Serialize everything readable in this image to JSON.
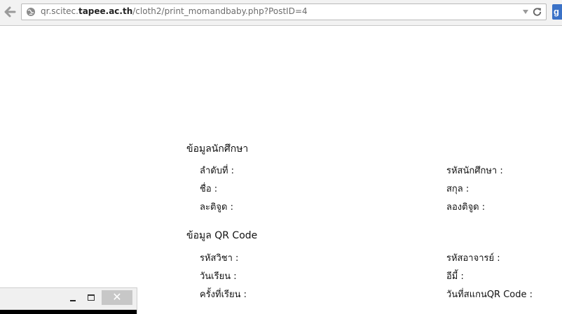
{
  "browser": {
    "url_prefix": "qr.scitec.",
    "url_domain": "tapee.ac.th",
    "url_path": "/cloth2/print_momandbaby.php?PostID=4",
    "back_icon": "back-arrow-icon",
    "site_icon": "globe-icon",
    "reload_icon": "reload-icon",
    "extension_letter": "g"
  },
  "student_section": {
    "title": "ข้อมูลนักศึกษา",
    "fields": {
      "order_label": "ลำดับที่ :",
      "student_id_label": "รหัสนักศึกษา :",
      "first_name_label": "ชื่อ :",
      "last_name_label": "สกุล :",
      "latitude_label": "ละติจูด :",
      "longitude_label": "ลองติจูด :"
    }
  },
  "qr_section": {
    "title": "ข้อมูล QR Code",
    "fields": {
      "course_code_label": "รหัสวิชา :",
      "teacher_code_label": "รหัสอาจารย์ :",
      "study_date_label": "วันเรียน :",
      "email_label": "อีมี้ :",
      "session_label": "ครั้งที่เรียน :",
      "scan_date_label": "วันที่สแกนQR Code :"
    }
  },
  "mini_window": {
    "close_glyph": "✕"
  },
  "colors": {
    "toolbar_bg": "#f2f2f2",
    "extension_blue": "#3b72c7",
    "close_button": "#c7c7c7"
  }
}
